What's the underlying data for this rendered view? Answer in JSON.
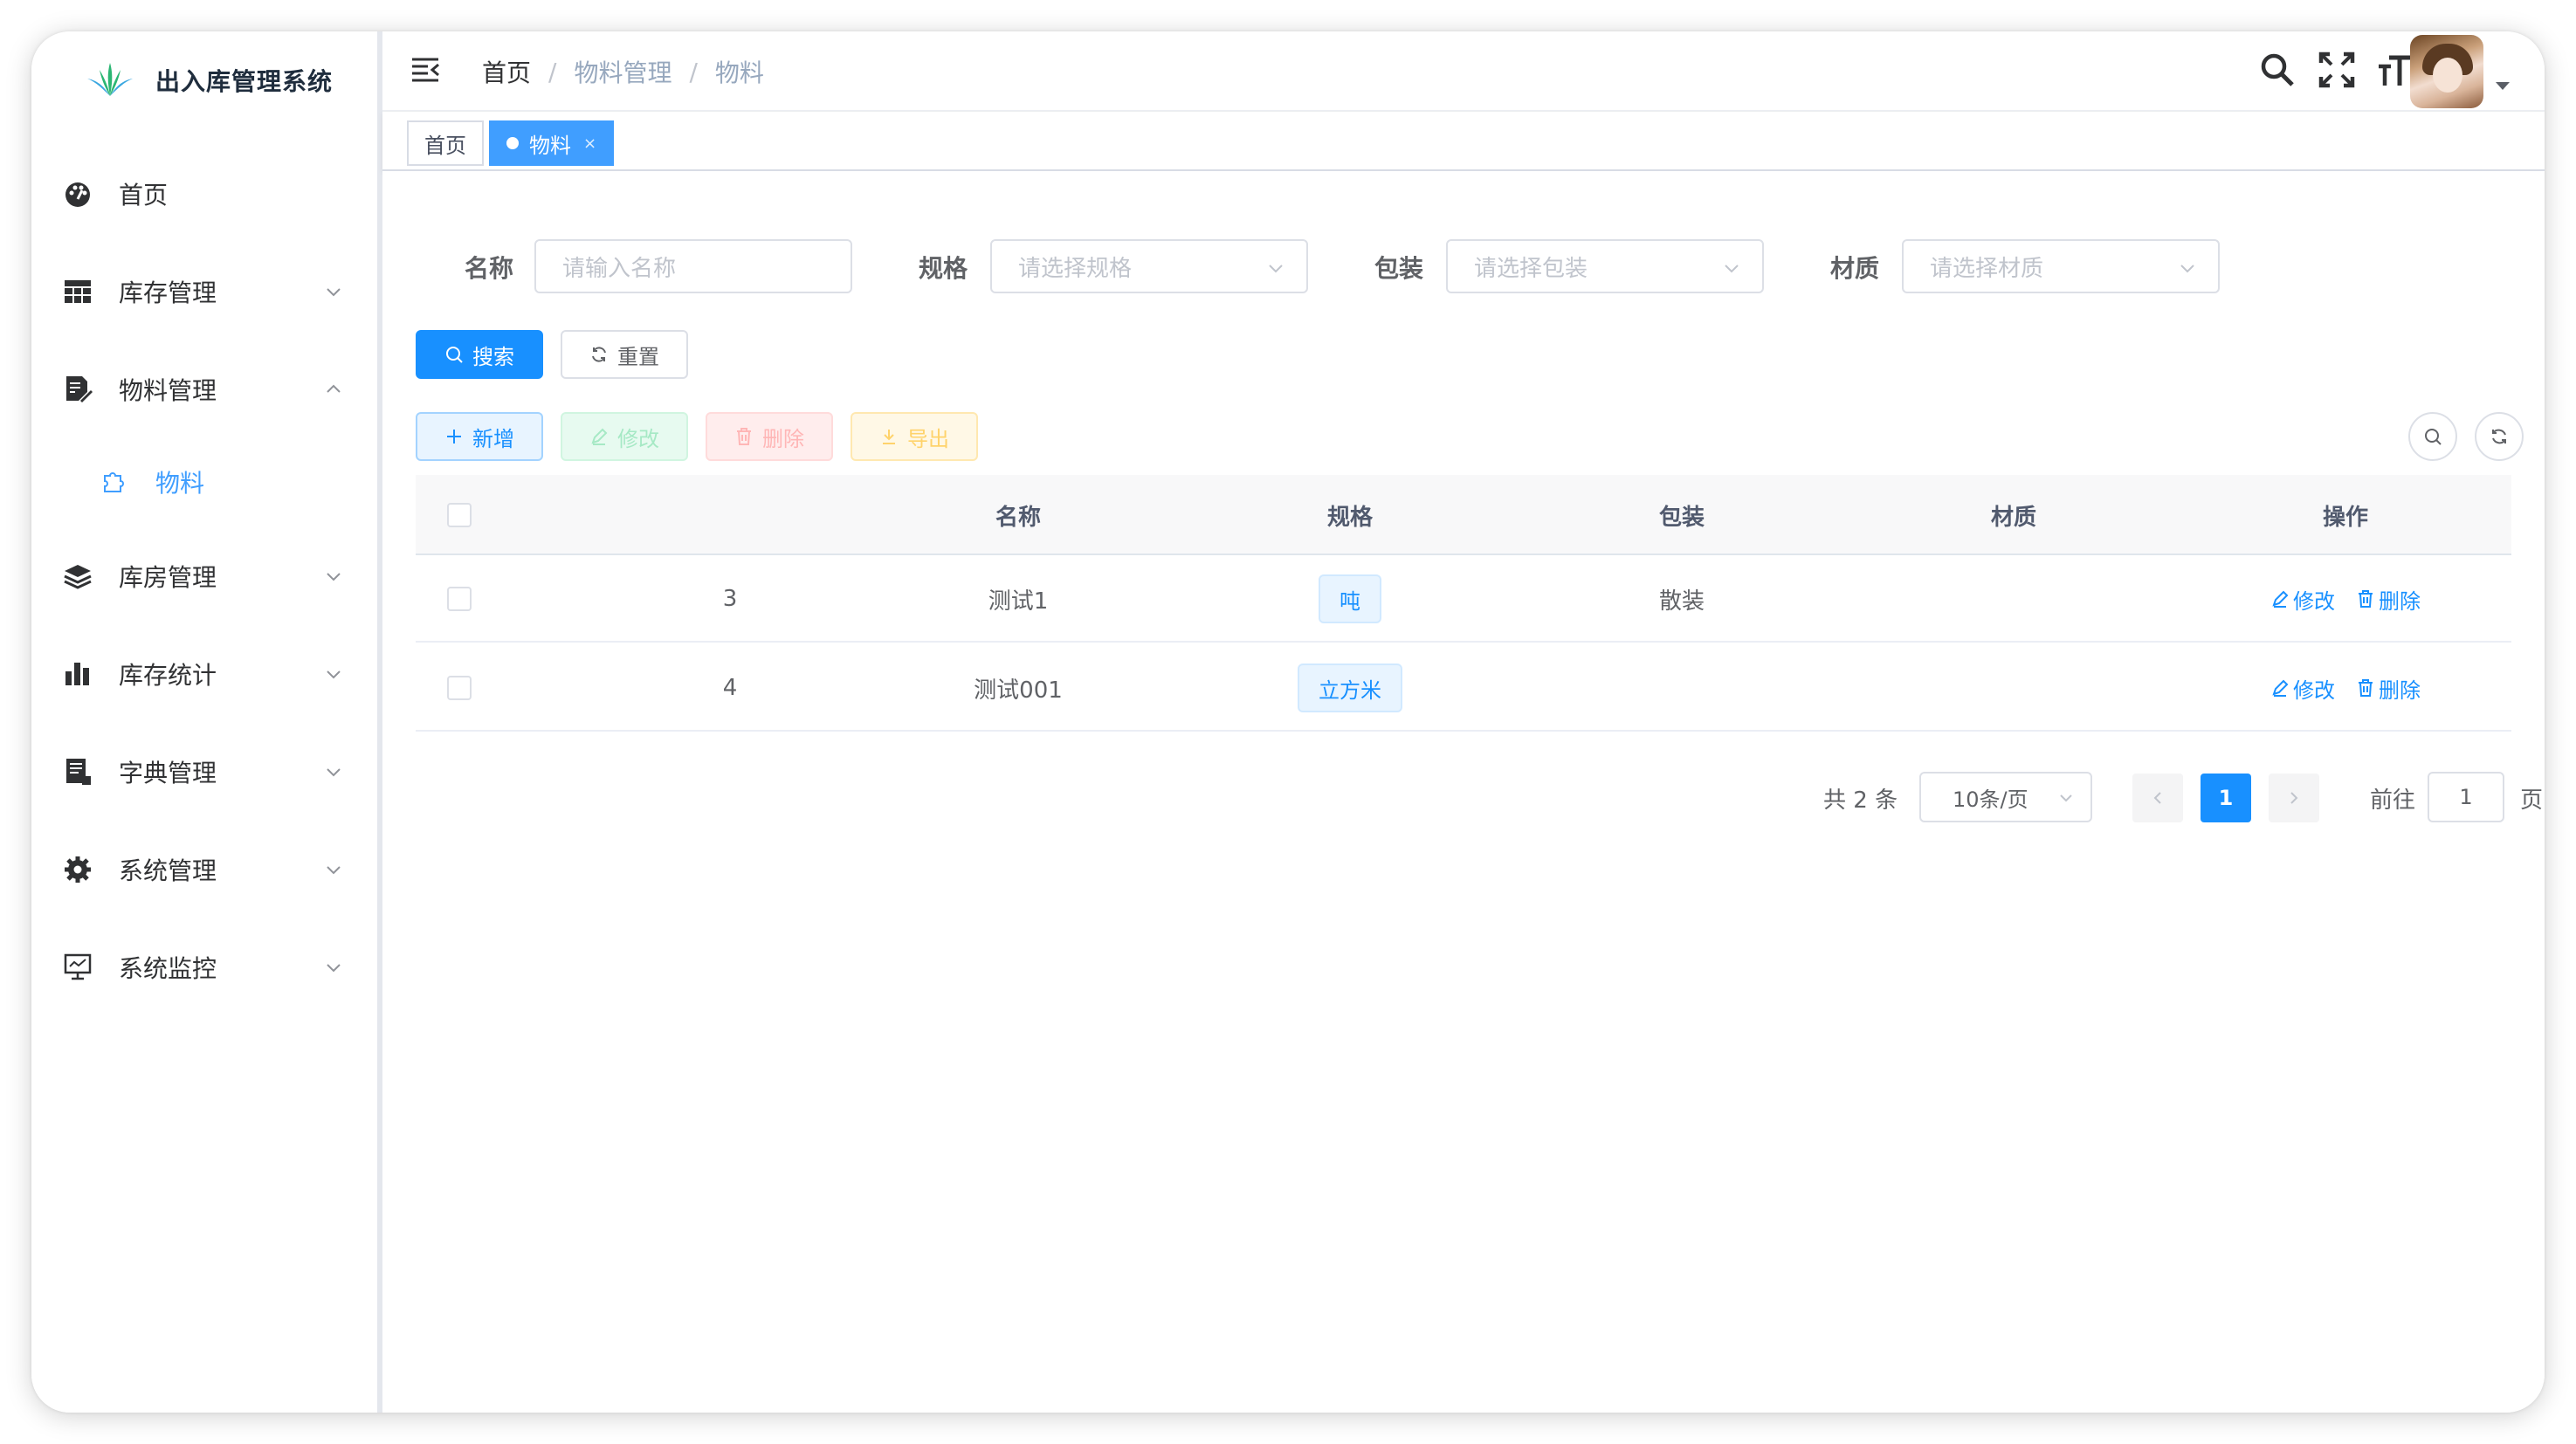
{
  "app": {
    "title": "出入库管理系统"
  },
  "sidebar": {
    "items": [
      {
        "label": "首页",
        "icon": "dashboard-icon"
      },
      {
        "label": "库存管理",
        "icon": "table-icon"
      },
      {
        "label": "物料管理",
        "icon": "edit-doc-icon",
        "expanded": true
      },
      {
        "label": "物料",
        "icon": "puzzle-icon",
        "active": true
      },
      {
        "label": "库房管理",
        "icon": "layers-icon"
      },
      {
        "label": "库存统计",
        "icon": "bar-chart-icon"
      },
      {
        "label": "字典管理",
        "icon": "dictionary-icon"
      },
      {
        "label": "系统管理",
        "icon": "gear-icon"
      },
      {
        "label": "系统监控",
        "icon": "monitor-icon"
      }
    ]
  },
  "breadcrumb": {
    "home": "首页",
    "level1": "物料管理",
    "level2": "物料",
    "sep": "/"
  },
  "tags": {
    "home": "首页",
    "active": "物料",
    "close": "×"
  },
  "search_form": {
    "name_label": "名称",
    "name_placeholder": "请输入名称",
    "spec_label": "规格",
    "spec_placeholder": "请选择规格",
    "pack_label": "包装",
    "pack_placeholder": "请选择包装",
    "material_label": "材质",
    "material_placeholder": "请选择材质",
    "search_btn": "搜索",
    "reset_btn": "重置"
  },
  "toolbar": {
    "add": "新增",
    "edit": "修改",
    "delete": "删除",
    "export": "导出"
  },
  "table": {
    "headers": [
      "名称",
      "规格",
      "包装",
      "材质",
      "操作"
    ],
    "rows": [
      {
        "id": "3",
        "name": "测试1",
        "spec": "吨",
        "pack": "散装",
        "material": "",
        "edit": "修改",
        "delete": "删除"
      },
      {
        "id": "4",
        "name": "测试001",
        "spec": "立方米",
        "pack": "",
        "material": "",
        "edit": "修改",
        "delete": "删除"
      }
    ]
  },
  "pagination": {
    "total": "共 2 条",
    "page_size": "10条/页",
    "current": "1",
    "goto_label": "前往",
    "goto_value": "1",
    "page_suffix": "页"
  },
  "colors": {
    "primary": "#1890ff",
    "sidebar_active": "#409eff"
  }
}
